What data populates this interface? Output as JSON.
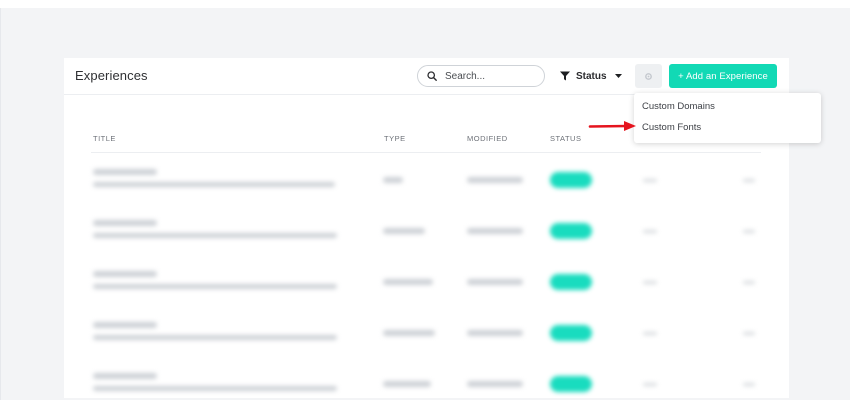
{
  "header": {
    "title": "Experiences",
    "search_placeholder": "Search...",
    "status_label": "Status",
    "add_button": "+ Add an Experience"
  },
  "table": {
    "columns": [
      "TITLE",
      "TYPE",
      "MODIFIED",
      "STATUS"
    ],
    "rows": 5
  },
  "dropdown": {
    "items": [
      "Custom Domains",
      "Custom Fonts"
    ],
    "highlighted": "Custom Fonts"
  },
  "colors": {
    "accent": "#12d9b5",
    "annotation_arrow": "#e5141e"
  },
  "icons": {
    "search": "search-icon",
    "filter": "filter-icon",
    "caret": "caret-down-icon",
    "settings": "gear-icon",
    "annotation": "red-arrow-icon"
  }
}
